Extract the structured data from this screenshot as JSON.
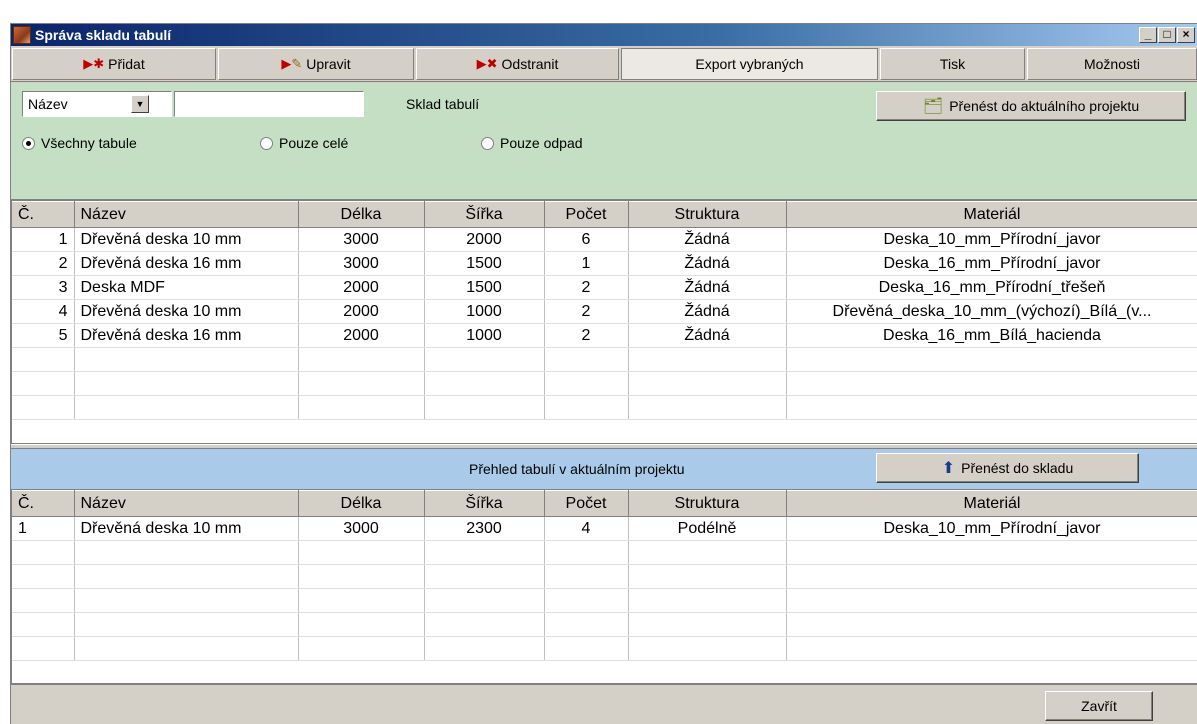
{
  "window": {
    "title": "Správa skladu tabulí"
  },
  "toolbar": {
    "add": "Přidat",
    "edit": "Upravit",
    "delete": "Odstranit",
    "export": "Export vybraných",
    "print": "Tisk",
    "options": "Možnosti"
  },
  "filter": {
    "field_select": "Název",
    "search_value": "",
    "panel_title": "Sklad tabulí",
    "transfer_button": "Přenést do aktuálního projektu",
    "radio_all": "Všechny tabule",
    "radio_whole": "Pouze celé",
    "radio_waste": "Pouze odpad",
    "selected_radio": "radio_all"
  },
  "stock_table": {
    "headers": [
      "Č.",
      "Název",
      "Délka",
      "Šířka",
      "Počet",
      "Struktura",
      "Materiál"
    ],
    "rows": [
      [
        "1",
        "Dřevěná deska 10 mm",
        "3000",
        "2000",
        "6",
        "Žádná",
        "Deska_10_mm_Přírodní_javor"
      ],
      [
        "2",
        "Dřevěná deska 16 mm",
        "3000",
        "1500",
        "1",
        "Žádná",
        "Deska_16_mm_Přírodní_javor"
      ],
      [
        "3",
        "Deska MDF",
        "2000",
        "1500",
        "2",
        "Žádná",
        "Deska_16_mm_Přírodní_třešeň"
      ],
      [
        "4",
        "Dřevěná deska 10 mm",
        "2000",
        "1000",
        "2",
        "Žádná",
        "Dřevěná_deska_10_mm_(výchozí)_Bílá_(v..."
      ],
      [
        "5",
        "Dřevěná deska 16 mm",
        "2000",
        "1000",
        "2",
        "Žádná",
        "Deska_16_mm_Bílá_hacienda"
      ]
    ]
  },
  "project_panel": {
    "title": "Přehled tabulí v aktuálním projektu",
    "transfer_button": "Přenést do skladu"
  },
  "project_table": {
    "headers": [
      "Č.",
      "Název",
      "Délka",
      "Šířka",
      "Počet",
      "Struktura",
      "Materiál"
    ],
    "rows": [
      [
        "1",
        "Dřevěná deska 10 mm",
        "3000",
        "2300",
        "4",
        "Podélně",
        "Deska_10_mm_Přírodní_javor"
      ]
    ]
  },
  "footer": {
    "close_button": "Zavřít"
  },
  "colors": {
    "title_bar": "#0a246a",
    "filter_panel": "#c4dfc4",
    "project_panel": "#a9cbe9",
    "window_face": "#d4d0c8"
  }
}
